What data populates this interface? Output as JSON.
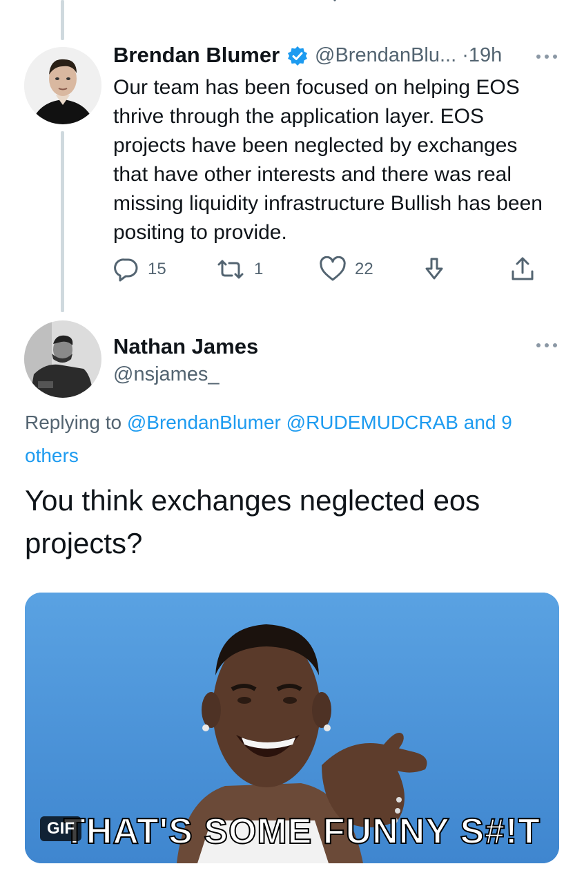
{
  "tweet1": {
    "author_name": "Brendan Blumer",
    "handle": "@BrendanBlu...",
    "time": "19h",
    "separator": "·",
    "text": "Our team has been focused on helping EOS thrive through the application layer. EOS projects have been neglected by exchanges that have other interests and there was real missing liquidity infrastructure Bullish has been positing to provide.",
    "replies": "15",
    "retweets": "1",
    "likes": "22"
  },
  "tweet2": {
    "author_name": "Nathan James",
    "handle": "@nsjames_",
    "replying_prefix": "Replying to ",
    "replying_to_1": "@BrendanBlumer",
    "replying_to_2": "@RUDEMUDCRAB",
    "replying_and": " and ",
    "replying_others": "9 others",
    "text": "You think exchanges neglected eos projects?",
    "gif_badge": "GIF",
    "gif_caption": "THAT'S SOME FUNNY S#!T"
  },
  "colors": {
    "accent": "#1d9bf0",
    "secondary_text": "#536471",
    "thread_line": "#cfd9de",
    "gif_sky": "#4a95d9"
  },
  "icons": [
    "reply-icon",
    "retweet-icon",
    "like-icon",
    "download-icon",
    "share-icon",
    "verified-badge-icon",
    "more-icon"
  ]
}
